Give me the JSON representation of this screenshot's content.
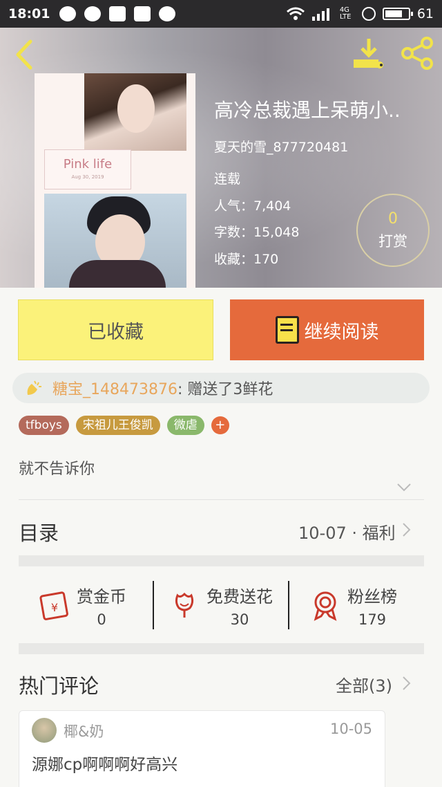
{
  "status_bar": {
    "time": "18:01",
    "network": "4G LTE",
    "battery": "61"
  },
  "book": {
    "title": "高冷总裁遇上呆萌小..",
    "author": "夏天的雪_877720481",
    "serial_status": "连载",
    "popularity": "人气：7,404",
    "words": "字数：15,048",
    "favorites": "收藏：170",
    "cover_text": "Pink life",
    "cover_subtext": "Aug 30, 2019"
  },
  "tip": {
    "count": "0",
    "label": "打赏"
  },
  "actions": {
    "collected_label": "已收藏",
    "continue_label": "继续阅读"
  },
  "gift": {
    "user": "糖宝_148473876",
    "message": " : 赠送了3鲜花"
  },
  "tags": [
    "tfboys",
    "宋祖儿王俊凯",
    "微虐"
  ],
  "tag_add": "+",
  "description": "就不告诉你",
  "toc": {
    "label": "目录",
    "latest": "10-07 · 福利"
  },
  "stats": [
    {
      "label": "赏金币",
      "value": "0",
      "icon": "red-envelope-icon"
    },
    {
      "label": "免费送花",
      "value": "30",
      "icon": "flower-icon"
    },
    {
      "label": "粉丝榜",
      "value": "179",
      "icon": "medal-icon"
    }
  ],
  "hot_comments": {
    "label": "热门评论",
    "all_label": "全部(3)",
    "items": [
      {
        "user": "椰&奶",
        "date": "10-05",
        "text": "源娜cp啊啊啊好高兴"
      }
    ]
  },
  "colors": {
    "accent": "#e56a3c",
    "yellow": "#fbf27a",
    "gift_user": "#e8a65c",
    "tip_number": "#f4e06c"
  }
}
